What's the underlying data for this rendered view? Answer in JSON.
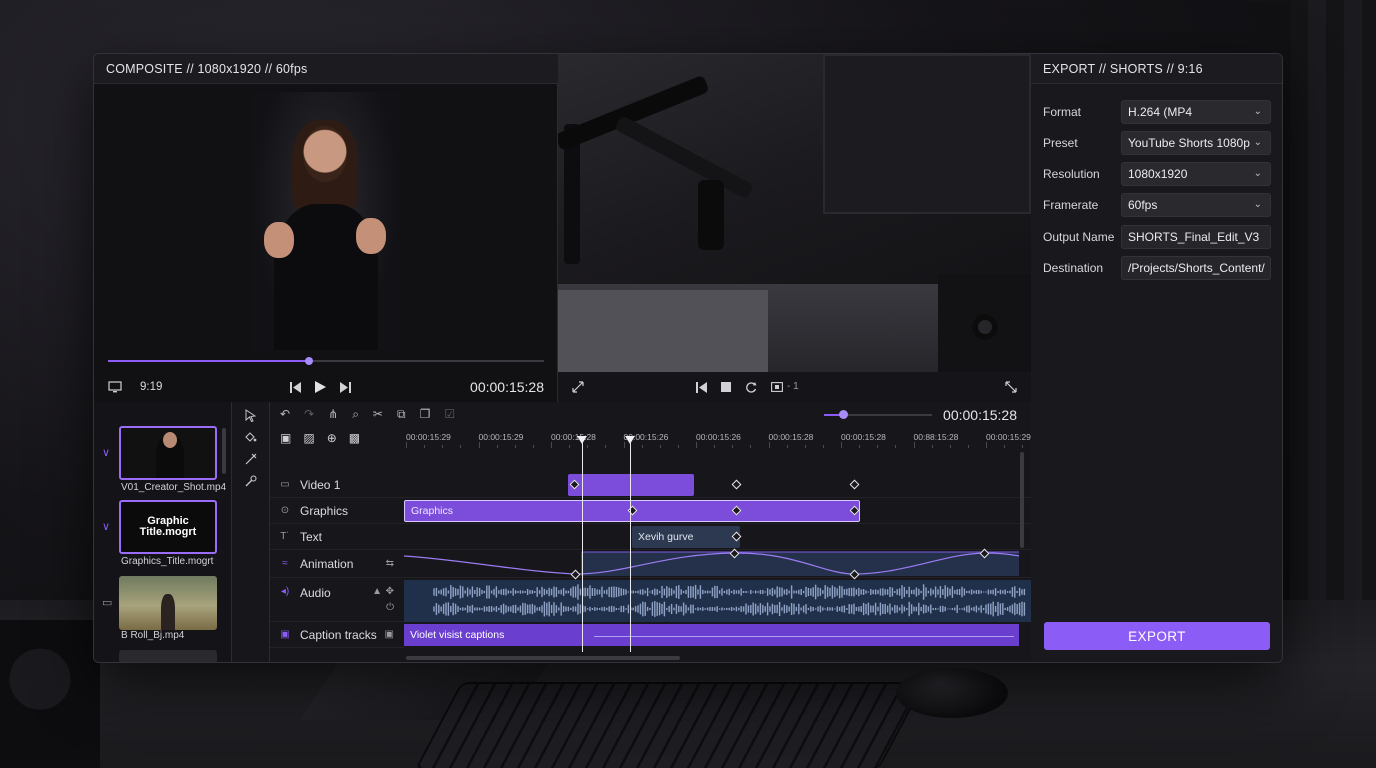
{
  "composite": {
    "title": "COMPOSITE // 1080x1920 // 60fps",
    "aspect": "9:19",
    "timecode": "00:00:15:28",
    "progress_pct": 46
  },
  "program": {
    "loop_label": "- 1"
  },
  "export": {
    "title": "EXPORT // SHORTS // 9:16",
    "fields": [
      {
        "label": "Format",
        "value": "H.264 (MP4",
        "type": "select"
      },
      {
        "label": "Preset",
        "value": "YouTube Shorts 1080p",
        "type": "select"
      },
      {
        "label": "Resolution",
        "value": "1080x1920",
        "type": "select"
      },
      {
        "label": "Framerate",
        "value": "60fps",
        "type": "select"
      },
      {
        "label": "Output Name",
        "value": "SHORTS_Final_Edit_V3",
        "type": "text"
      },
      {
        "label": "Destination",
        "value": "/Projects/Shorts_Content/",
        "type": "text"
      }
    ],
    "button": "EXPORT"
  },
  "project": {
    "clips": [
      {
        "name": "V01_Creator_Shot.mp4",
        "selected": true
      },
      {
        "name": "Graphics_Title.mogrt",
        "thumb_text": "Graphic Title.mogrt",
        "selected": true
      },
      {
        "name": "B Roll_Bj.mp4",
        "selected": false
      }
    ]
  },
  "timeline": {
    "timecode": "00:00:15:28",
    "zoom_pct": 18,
    "ruler": [
      "00:00:15:29",
      "00:00:15:29",
      "00:00:15:28",
      "00:00:15:26",
      "00:00:15:26",
      "00:00:15:28",
      "00:00:15:28",
      "00:88:15:28",
      "00:00:15:29"
    ],
    "tracks": [
      {
        "name": "Video 1"
      },
      {
        "name": "Graphics"
      },
      {
        "name": "Text"
      },
      {
        "name": "Animation"
      },
      {
        "name": "Audio"
      },
      {
        "name": "Caption tracks"
      }
    ],
    "clips": {
      "graphics": "Graphics",
      "text": "Xevih gurve",
      "caption": "Violet visist captions"
    }
  },
  "colors": {
    "accent": "#8b5cf6",
    "clip": "#7c4ddb",
    "audio_bg": "#21304a",
    "panel": "#19181c"
  }
}
